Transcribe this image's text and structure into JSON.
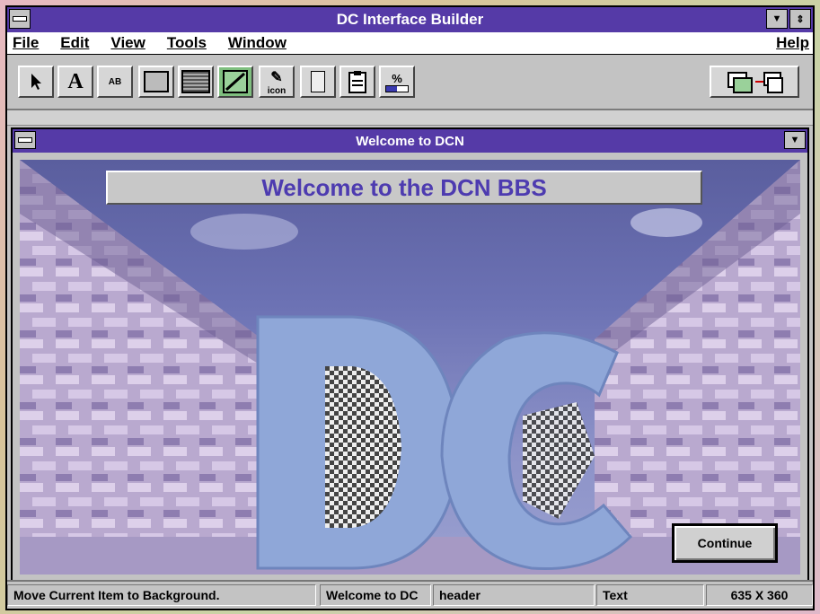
{
  "app": {
    "title": "DC Interface Builder"
  },
  "menu": {
    "items": [
      "File",
      "Edit",
      "View",
      "Tools",
      "Window"
    ],
    "help": "Help"
  },
  "toolbar": {
    "tools": [
      {
        "name": "pointer-tool",
        "icon": "arrow-pointer-icon"
      },
      {
        "name": "text-tool",
        "icon": "letter-a-icon",
        "label": "A"
      },
      {
        "name": "label-field-tool",
        "icon": "label-field-icon",
        "label": "AB"
      },
      {
        "name": "rectangle-tool",
        "icon": "rectangle-icon"
      },
      {
        "name": "list-tool",
        "icon": "list-box-icon"
      },
      {
        "name": "line-tool",
        "icon": "diagonal-line-icon"
      },
      {
        "name": "icon-tool",
        "icon": "palette-icon",
        "label": "icon"
      },
      {
        "name": "button-tool",
        "icon": "button-icon"
      },
      {
        "name": "clipboard-tool",
        "icon": "clipboard-icon"
      },
      {
        "name": "progress-tool",
        "icon": "percent-bar-icon",
        "label": "%"
      }
    ],
    "right_tool": {
      "name": "switch-window-tool",
      "icon": "window-transfer-icon"
    }
  },
  "child_window": {
    "title": "Welcome to DCN",
    "banner": "Welcome to the DCN BBS",
    "logo_text": "DC",
    "continue_label": "Continue"
  },
  "status": {
    "message": "Move Current Item to Background.",
    "item_name": "Welcome to DC",
    "item_type": "header",
    "kind": "Text",
    "size": "635 X 360"
  },
  "colors": {
    "titlebar": "#553aa7",
    "banner_text": "#4d3bb0",
    "chrome": "#c3c3c3"
  }
}
